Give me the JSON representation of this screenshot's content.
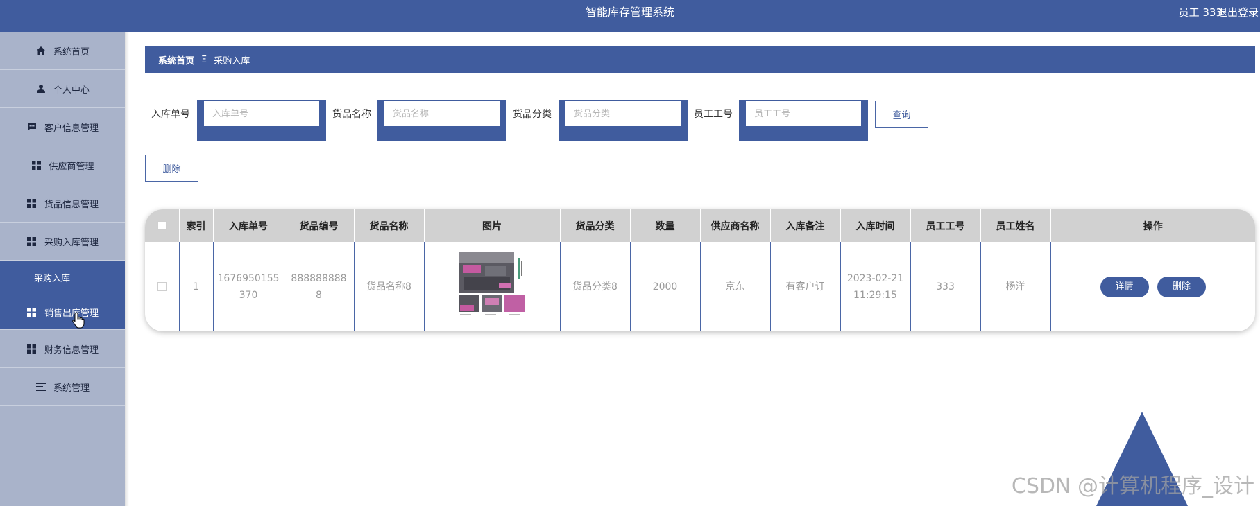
{
  "header": {
    "title": "智能库存管理系统",
    "user": "员工 333",
    "logout": "退出登录"
  },
  "sidebar": {
    "items": [
      {
        "label": "系统首页",
        "icon": "home-icon"
      },
      {
        "label": "个人中心",
        "icon": "user-icon"
      },
      {
        "label": "客户信息管理",
        "icon": "chat-icon"
      },
      {
        "label": "供应商管理",
        "icon": "grid-icon"
      },
      {
        "label": "货品信息管理",
        "icon": "grid-icon"
      },
      {
        "label": "采购入库管理",
        "icon": "grid-icon"
      },
      {
        "label": "采购入库",
        "icon": ""
      },
      {
        "label": "销售出库管理",
        "icon": "grid-icon"
      },
      {
        "label": "财务信息管理",
        "icon": "grid-icon"
      },
      {
        "label": "系统管理",
        "icon": "menu-icon"
      }
    ]
  },
  "breadcrumb": {
    "home": "系统首页",
    "separator": "Ξ",
    "current": "采购入库"
  },
  "search": {
    "fields": [
      {
        "label": "入库单号",
        "placeholder": "入库单号"
      },
      {
        "label": "货品名称",
        "placeholder": "货品名称"
      },
      {
        "label": "货品分类",
        "placeholder": "货品分类"
      },
      {
        "label": "员工工号",
        "placeholder": "员工工号"
      }
    ],
    "query_button": "查询"
  },
  "actions": {
    "delete_button": "删除"
  },
  "table": {
    "headers": [
      "索引",
      "入库单号",
      "货品编号",
      "货品名称",
      "图片",
      "货品分类",
      "数量",
      "供应商名称",
      "入库备注",
      "入库时间",
      "员工工号",
      "员工姓名",
      "操作"
    ],
    "rows": [
      {
        "index": "1",
        "order_no_1": "1676950155",
        "order_no_2": "370",
        "goods_no_1": "888888888",
        "goods_no_2": "8",
        "goods_name": "货品名称8",
        "category": "货品分类8",
        "quantity": "2000",
        "supplier": "京东",
        "remark": "有客户订",
        "time_1": "2023-02-21",
        "time_2": "11:29:15",
        "staff_no": "333",
        "staff_name": "杨洋",
        "detail_button": "详情",
        "delete_button": "删除"
      }
    ]
  },
  "watermark": "CSDN @计算机程序_设计",
  "colors": {
    "primary": "#405c9e",
    "sidebar": "#a9b3ca",
    "table_header": "#d1d1d1"
  }
}
